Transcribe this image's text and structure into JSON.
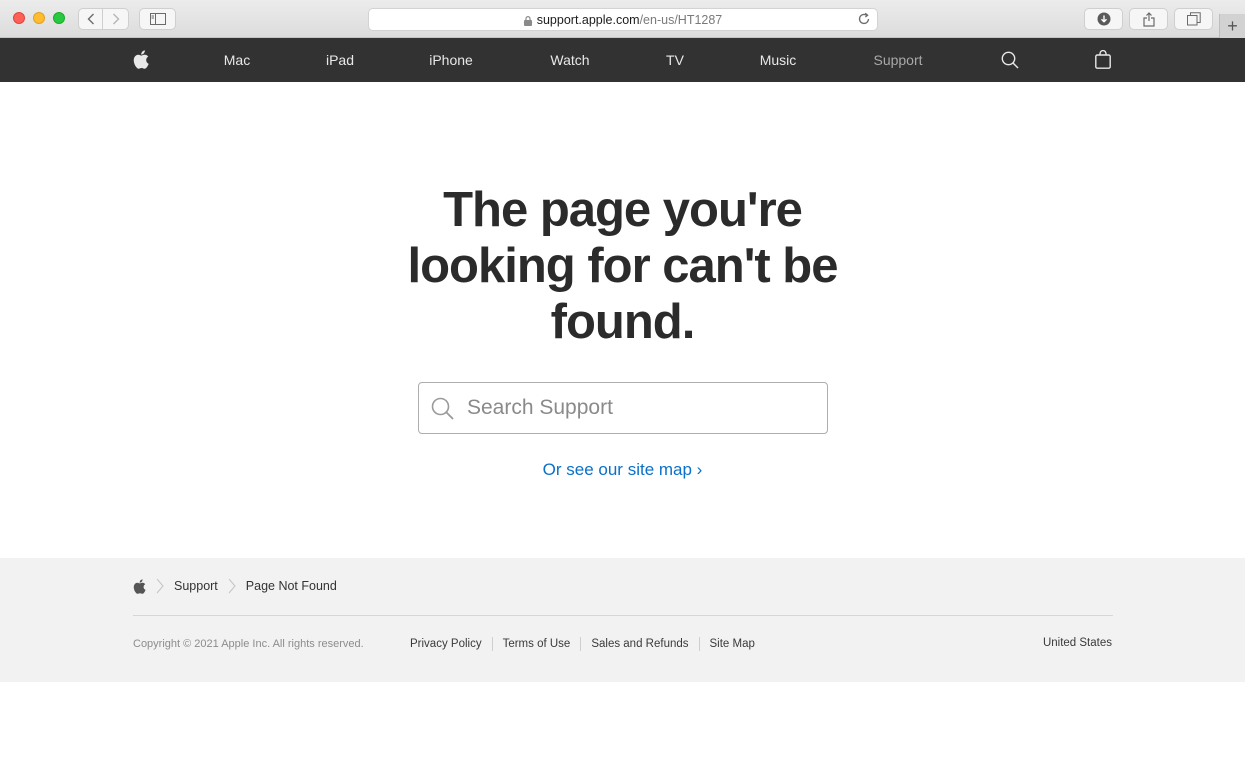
{
  "browser": {
    "url_host": "support.apple.com",
    "url_path": "/en-us/HT1287",
    "new_tab_label": "+"
  },
  "gnav": {
    "items": [
      {
        "label": "Mac"
      },
      {
        "label": "iPad"
      },
      {
        "label": "iPhone"
      },
      {
        "label": "Watch"
      },
      {
        "label": "TV"
      },
      {
        "label": "Music"
      },
      {
        "label": "Support",
        "active": true
      }
    ],
    "icons": [
      "apple-logo-icon",
      "search-icon",
      "bag-icon"
    ]
  },
  "main": {
    "headline_line1": "The page you're",
    "headline_line2": "looking for can't be",
    "headline_line3": "found.",
    "search_placeholder": "Search Support",
    "sitemap_link": "Or see our site map ›"
  },
  "footer": {
    "breadcrumbs": [
      "Support",
      "Page Not Found"
    ],
    "copyright": "Copyright © 2021 Apple Inc. All rights reserved.",
    "links": [
      "Privacy Policy",
      "Terms of Use",
      "Sales and Refunds",
      "Site Map"
    ],
    "country": "United States"
  },
  "colors": {
    "nav_bg": "#323232",
    "link_blue": "#0a70c9",
    "footer_bg": "#f2f2f2",
    "headline": "#2b2b2b"
  }
}
